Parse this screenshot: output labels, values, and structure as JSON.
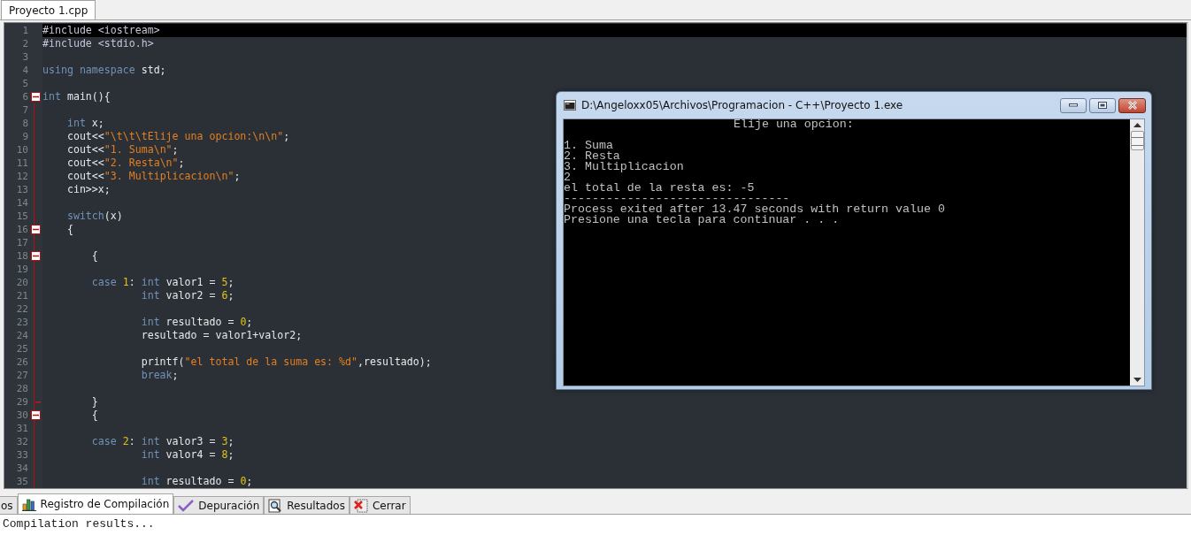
{
  "editor_tabs": [
    {
      "label": "Proyecto 1.cpp",
      "selected": true
    }
  ],
  "code_lines": [
    {
      "number": "1",
      "highlighted": true,
      "tokens": [
        {
          "kind": "preproc",
          "text": "#include <iostream>"
        }
      ]
    },
    {
      "number": "2",
      "highlighted": false,
      "tokens": [
        {
          "kind": "preproc",
          "text": "#include <stdio.h>"
        }
      ]
    },
    {
      "number": "3",
      "highlighted": false
    },
    {
      "number": "4",
      "highlighted": false,
      "tokens": [
        {
          "kind": "keyword",
          "text": "using namespace"
        },
        {
          "kind": "plain",
          "text": " std;"
        }
      ]
    },
    {
      "number": "5",
      "highlighted": false
    },
    {
      "number": "6",
      "highlighted": false,
      "kind": "fold",
      "tokens": [
        {
          "kind": "keyword",
          "text": "int"
        },
        {
          "kind": "plain",
          "text": " main(){"
        }
      ]
    },
    {
      "number": "7",
      "highlighted": false
    },
    {
      "number": "8",
      "highlighted": false,
      "tokens": [
        {
          "kind": "keyword",
          "text": "    int"
        },
        {
          "kind": "plain",
          "text": " x;"
        }
      ]
    },
    {
      "number": "9",
      "highlighted": false,
      "tokens": [
        {
          "kind": "plain",
          "text": "    cout<<"
        },
        {
          "kind": "string",
          "text": "\"\\t\\t\\tElije una opcion:\\n\\n\""
        },
        {
          "kind": "plain",
          "text": ";"
        }
      ]
    },
    {
      "number": "10",
      "highlighted": false,
      "tokens": [
        {
          "kind": "plain",
          "text": "    cout<<"
        },
        {
          "kind": "string",
          "text": "\"1. Suma\\n\""
        },
        {
          "kind": "plain",
          "text": ";"
        }
      ]
    },
    {
      "number": "11",
      "highlighted": false,
      "tokens": [
        {
          "kind": "plain",
          "text": "    cout<<"
        },
        {
          "kind": "string",
          "text": "\"2. Resta\\n\""
        },
        {
          "kind": "plain",
          "text": ";"
        }
      ]
    },
    {
      "number": "12",
      "highlighted": false,
      "tokens": [
        {
          "kind": "plain",
          "text": "    cout<<"
        },
        {
          "kind": "string",
          "text": "\"3. Multiplicacion\\n\""
        },
        {
          "kind": "plain",
          "text": ";"
        }
      ]
    },
    {
      "number": "13",
      "highlighted": false,
      "tokens": [
        {
          "kind": "plain",
          "text": "    cin>>x;"
        }
      ]
    },
    {
      "number": "14",
      "highlighted": false
    },
    {
      "number": "15",
      "highlighted": false,
      "tokens": [
        {
          "kind": "keyword",
          "text": "    switch"
        },
        {
          "kind": "plain",
          "text": "(x)"
        }
      ]
    },
    {
      "number": "16",
      "highlighted": false,
      "kind": "fold",
      "tokens": [
        {
          "kind": "plain",
          "text": "    {"
        }
      ]
    },
    {
      "number": "17",
      "highlighted": false
    },
    {
      "number": "18",
      "highlighted": false,
      "kind": "fold",
      "tokens": [
        {
          "kind": "plain",
          "text": "        {"
        }
      ]
    },
    {
      "number": "19",
      "highlighted": false
    },
    {
      "number": "20",
      "highlighted": false,
      "tokens": [
        {
          "kind": "keyword",
          "text": "        case "
        },
        {
          "kind": "number",
          "text": "1"
        },
        {
          "kind": "plain",
          "text": ": "
        },
        {
          "kind": "keyword",
          "text": "int"
        },
        {
          "kind": "plain",
          "text": " valor1 = "
        },
        {
          "kind": "number",
          "text": "5"
        },
        {
          "kind": "plain",
          "text": ";"
        }
      ]
    },
    {
      "number": "21",
      "highlighted": false,
      "tokens": [
        {
          "kind": "keyword",
          "text": "                int"
        },
        {
          "kind": "plain",
          "text": " valor2 = "
        },
        {
          "kind": "number",
          "text": "6"
        },
        {
          "kind": "plain",
          "text": ";"
        }
      ]
    },
    {
      "number": "22",
      "highlighted": false
    },
    {
      "number": "23",
      "highlighted": false,
      "tokens": [
        {
          "kind": "keyword",
          "text": "                int"
        },
        {
          "kind": "plain",
          "text": " resultado = "
        },
        {
          "kind": "number",
          "text": "0"
        },
        {
          "kind": "plain",
          "text": ";"
        }
      ]
    },
    {
      "number": "24",
      "highlighted": false,
      "tokens": [
        {
          "kind": "plain",
          "text": "                resultado = valor1+valor2;"
        }
      ]
    },
    {
      "number": "25",
      "highlighted": false
    },
    {
      "number": "26",
      "highlighted": false,
      "tokens": [
        {
          "kind": "plain",
          "text": "                printf("
        },
        {
          "kind": "string",
          "text": "\"el total de la suma es: %d\""
        },
        {
          "kind": "plain",
          "text": ",resultado);"
        }
      ]
    },
    {
      "number": "27",
      "highlighted": false,
      "tokens": [
        {
          "kind": "keyword",
          "text": "                break"
        },
        {
          "kind": "plain",
          "text": ";"
        }
      ]
    },
    {
      "number": "28",
      "highlighted": false
    },
    {
      "number": "29",
      "highlighted": false,
      "kind": "fold_end",
      "tokens": [
        {
          "kind": "plain",
          "text": "        }"
        }
      ]
    },
    {
      "number": "30",
      "highlighted": false,
      "kind": "fold",
      "tokens": [
        {
          "kind": "plain",
          "text": "        {"
        }
      ]
    },
    {
      "number": "31",
      "highlighted": false
    },
    {
      "number": "32",
      "highlighted": false,
      "tokens": [
        {
          "kind": "keyword",
          "text": "        case "
        },
        {
          "kind": "number",
          "text": "2"
        },
        {
          "kind": "plain",
          "text": ": "
        },
        {
          "kind": "keyword",
          "text": "int"
        },
        {
          "kind": "plain",
          "text": " valor3 = "
        },
        {
          "kind": "number",
          "text": "3"
        },
        {
          "kind": "plain",
          "text": ";"
        }
      ]
    },
    {
      "number": "33",
      "highlighted": false,
      "tokens": [
        {
          "kind": "keyword",
          "text": "                int"
        },
        {
          "kind": "plain",
          "text": " valor4 = "
        },
        {
          "kind": "number",
          "text": "8"
        },
        {
          "kind": "plain",
          "text": ";"
        }
      ]
    },
    {
      "number": "34",
      "highlighted": false
    },
    {
      "number": "35",
      "highlighted": false,
      "tokens": [
        {
          "kind": "keyword",
          "text": "                int"
        },
        {
          "kind": "plain",
          "text": " resultado = "
        },
        {
          "kind": "number",
          "text": "0"
        },
        {
          "kind": "plain",
          "text": ";"
        }
      ]
    }
  ],
  "console_window": {
    "title": "D:\\Angeloxx05\\Archivos\\Programacion - C++\\Proyecto 1.exe",
    "lines": [
      {
        "kind": "tabbed",
        "text": "Elije una opcion:"
      },
      {
        "kind": "plain",
        "text": "1. Suma"
      },
      {
        "kind": "plain",
        "text": "2. Resta"
      },
      {
        "kind": "plain",
        "text": "3. Multiplicacion"
      },
      {
        "kind": "plain",
        "text": "2"
      },
      {
        "kind": "plain",
        "text": "el total de la resta es: -5"
      },
      {
        "kind": "plain",
        "text": "--------------------------------"
      },
      {
        "kind": "tabbed_none",
        "text": "Process exited after 13.47 seconds with return value 0"
      },
      {
        "kind": "plain",
        "text": "Presione una tecla para continuar . . ."
      }
    ]
  },
  "bottom_tabs": [
    {
      "label": "os",
      "kind": "plain",
      "selected": false
    },
    {
      "label": "Registro de Compilación",
      "kind": "chart",
      "selected": true
    },
    {
      "label": "Depuración",
      "kind": "check",
      "selected": false
    },
    {
      "label": "Resultados",
      "kind": "search",
      "selected": false
    },
    {
      "label": "Cerrar",
      "kind": "close",
      "selected": false
    }
  ],
  "output_text": "Compilation results..."
}
